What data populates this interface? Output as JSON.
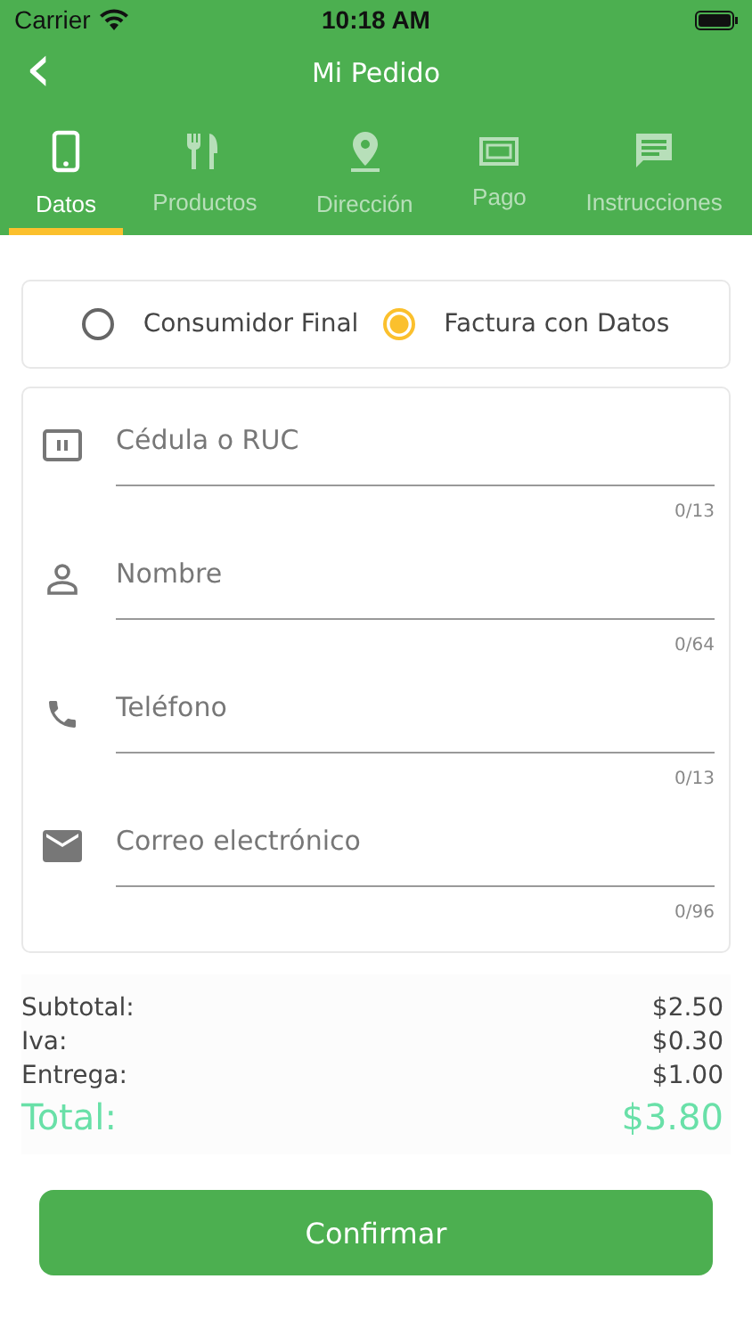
{
  "status_bar": {
    "carrier": "Carrier",
    "time": "10:18 AM"
  },
  "nav": {
    "back": "‹",
    "title": "Mi Pedido"
  },
  "tabs": [
    {
      "label": "Datos",
      "kind": "phone",
      "selected": true
    },
    {
      "label": "Productos",
      "kind": "cutlery",
      "selected": false
    },
    {
      "label": "Dirección",
      "kind": "pin",
      "selected": false
    },
    {
      "label": "Pago",
      "kind": "money",
      "selected": false
    },
    {
      "label": "Instrucciones",
      "kind": "chat",
      "selected": false
    }
  ],
  "invoice_type": [
    {
      "label": "Consumidor Final",
      "selected": false
    },
    {
      "label": "Factura con Datos",
      "selected": true
    }
  ],
  "fields": [
    {
      "kind": "id",
      "placeholder": "Cédula o RUC",
      "counter": "0/13"
    },
    {
      "kind": "person",
      "placeholder": "Nombre",
      "counter": "0/64"
    },
    {
      "kind": "phone",
      "placeholder": "Teléfono",
      "counter": "0/13"
    },
    {
      "kind": "mail",
      "placeholder": "Correo electrónico",
      "counter": "0/96"
    }
  ],
  "summary": [
    {
      "kind": "line",
      "label": "Subtotal:",
      "value": "$2.50"
    },
    {
      "kind": "line",
      "label": "Iva:",
      "value": "$0.30"
    },
    {
      "kind": "line",
      "label": "Entrega:",
      "value": "$1.00"
    },
    {
      "kind": "total",
      "label": "Total:",
      "value": "$3.80"
    }
  ],
  "confirm_button": "Confirmar"
}
